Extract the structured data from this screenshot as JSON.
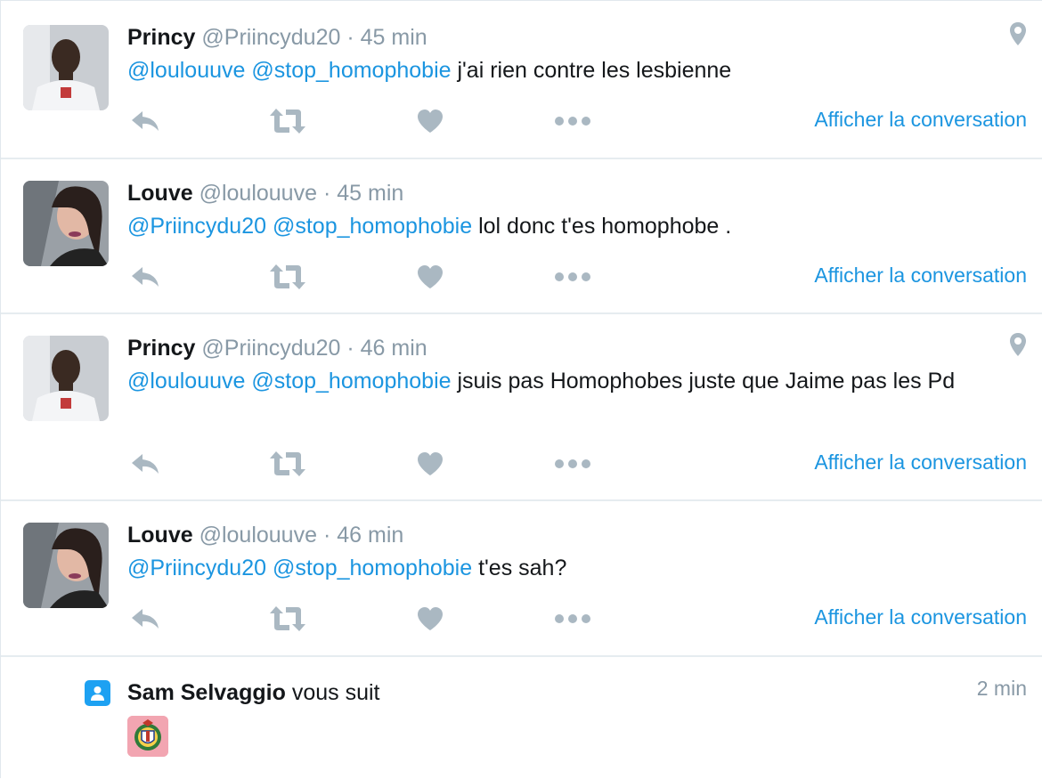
{
  "colors": {
    "accent": "#1b95e0",
    "muted": "#8899a6",
    "icon": "#aab8c2",
    "follow_badge": "#1da1f2"
  },
  "tweets": [
    {
      "fullname": "Princy",
      "username": "@Priincydu20",
      "dot": "·",
      "time": "45 min",
      "mentions": [
        "@loulouuve",
        "@stop_homophobie"
      ],
      "text": "j'ai rien contre les lesbienne",
      "has_location": true,
      "conversation_label": "Afficher la conversation"
    },
    {
      "fullname": "Louve",
      "username": "@loulouuve",
      "dot": "·",
      "time": "45 min",
      "mentions": [
        "@Priincydu20",
        "@stop_homophobie"
      ],
      "text": "lol donc t'es homophobe .",
      "has_location": false,
      "conversation_label": "Afficher la conversation"
    },
    {
      "fullname": "Princy",
      "username": "@Priincydu20",
      "dot": "·",
      "time": "46 min",
      "mentions": [
        "@loulouuve",
        "@stop_homophobie"
      ],
      "text": "jsuis pas Homophobes juste que Jaime pas les Pd",
      "has_location": true,
      "conversation_label": "Afficher la conversation"
    },
    {
      "fullname": "Louve",
      "username": "@loulouuve",
      "dot": "·",
      "time": "46 min",
      "mentions": [
        "@Priincydu20",
        "@stop_homophobie"
      ],
      "text": "t'es sah?",
      "has_location": false,
      "conversation_label": "Afficher la conversation"
    }
  ],
  "follow_notification": {
    "name": "Sam Selvaggio",
    "action": "vous suit",
    "time": "2 min",
    "icon": "person-badge-icon"
  },
  "icons": {
    "reply": "reply-icon",
    "retweet": "retweet-icon",
    "like": "heart-icon",
    "more": "more-dots-icon",
    "location": "location-pin-icon"
  }
}
